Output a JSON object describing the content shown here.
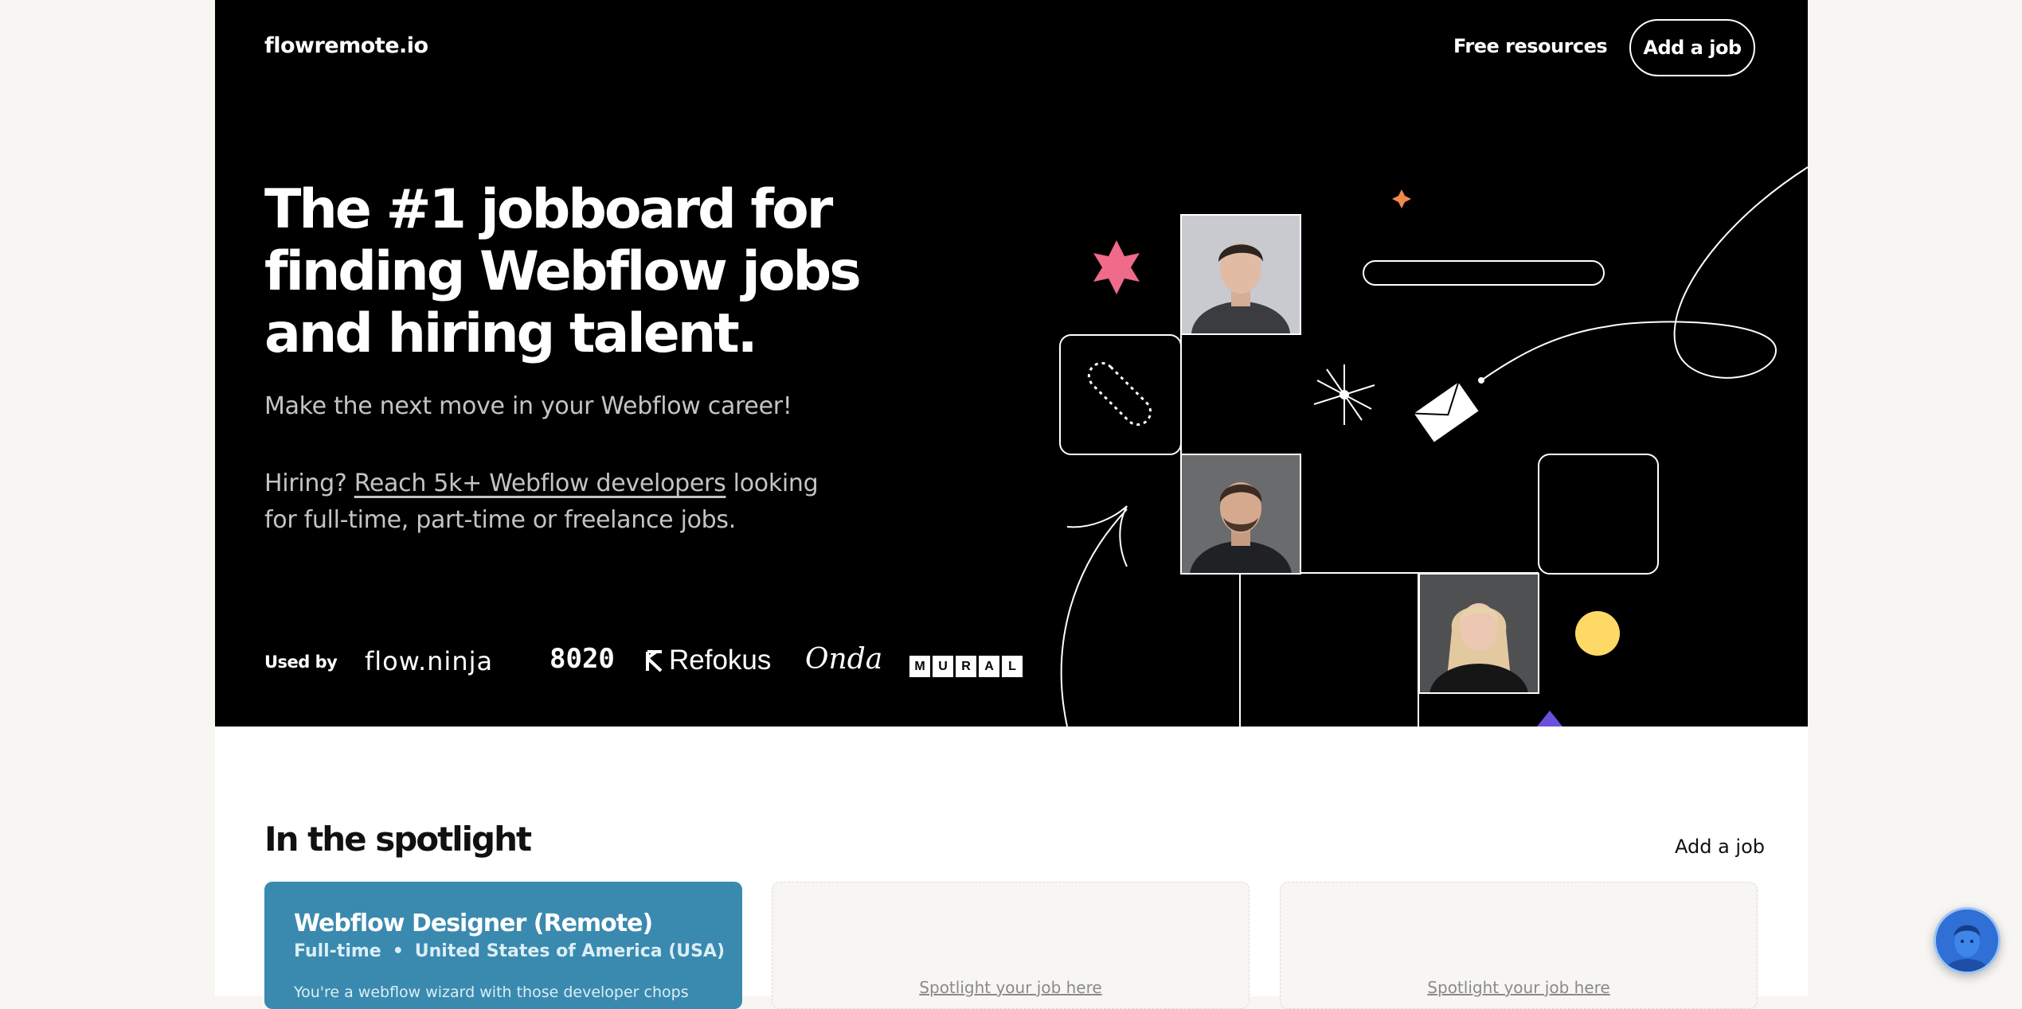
{
  "header": {
    "logo": "flowremote.io",
    "nav_free_resources": "Free resources",
    "nav_add_job": "Add a job"
  },
  "hero": {
    "title": "The #1 jobboard for finding Webflow jobs and hiring talent.",
    "subtitle": "Make the next move in your Webflow career!",
    "hiring_prefix": "Hiring?",
    "hiring_link": "Reach 5k+ Webflow developers",
    "hiring_suffix": "looking for full-time, part-time or freelance jobs."
  },
  "used_by": {
    "label": "Used by",
    "brands": [
      "flow.ninja",
      "8020",
      "Refokus",
      "Onda",
      "MURAL"
    ],
    "mural_letters": [
      "M",
      "U",
      "R",
      "A",
      "L"
    ]
  },
  "spotlight": {
    "title": "In the spotlight",
    "add_job": "Add a job",
    "featured_job": {
      "title": "Webflow Designer (Remote)",
      "type": "Full-time",
      "separator": "•",
      "location": "United States of America (USA)",
      "description": "You're a webflow wizard with those developer chops"
    },
    "empty_slot_text": "Spotlight your job here"
  },
  "colors": {
    "hero_bg": "#000000",
    "card_blue": "#3a8aaf",
    "star_pink": "#f06a8a",
    "sparkle_orange": "#f08a4b",
    "circle_yellow": "#ffd966",
    "triangle_purple": "#6d4fe0"
  },
  "icons": [
    "pink-star-icon",
    "orange-sparkle-icon",
    "envelope-icon",
    "paperclip-icon",
    "burst-icon",
    "arrow-icon",
    "chat-avatar-icon"
  ]
}
